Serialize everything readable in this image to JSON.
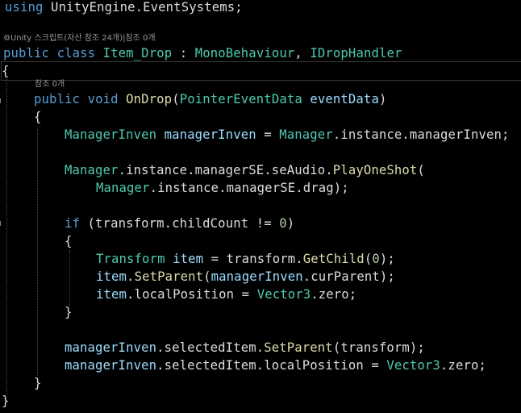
{
  "code": {
    "line_using": {
      "kw": "using",
      "ns": " UnityEngine.EventSystems;"
    },
    "lens_class": {
      "icon": "⚙",
      "text": "Unity 스크립트(자산 참조 24개)|참조 0개"
    },
    "line_class": {
      "kw1": "public",
      "sp1": " ",
      "kw2": "class",
      "sp2": " ",
      "name": "Item_Drop",
      "colon": " : ",
      "base1": "MonoBehaviour",
      "comma": ", ",
      "base2": "IDropHandler"
    },
    "line_open1": "{",
    "lens_method": "참조 0개",
    "line_method": {
      "kw1": "public",
      "sp1": " ",
      "kw2": "void",
      "sp2": " ",
      "name": "OnDrop",
      "p1": "(",
      "ptype": "PointerEventData",
      "sp3": " ",
      "pname": "eventData",
      "p2": ")"
    },
    "line_open2": "{",
    "line_mi": {
      "type": "ManagerInven",
      "sp": " ",
      "var": "managerInven",
      "eq": " = ",
      "cls": "Manager",
      "rest": ".instance.managerInven;"
    },
    "line_play": {
      "cls": "Manager",
      "rest": ".instance.managerSE.seAudio.",
      "method": "PlayOneShot",
      "p": "("
    },
    "line_play2": {
      "cls": "Manager",
      "rest": ".instance.managerSE.drag);"
    },
    "line_if": {
      "kw": "if",
      "a": " (transform.childCount != ",
      "num": "0",
      "b": ")"
    },
    "line_open3": "{",
    "line_t": {
      "type": "Transform",
      "sp": " ",
      "var": "item",
      "a": " = transform.",
      "method": "GetChild",
      "p1": "(",
      "num": "0",
      "p2": ");"
    },
    "line_sp": {
      "var": "item",
      "dot": ".",
      "method": "SetParent",
      "p1": "(",
      "var2": "managerInven",
      "rest": ".curParent);"
    },
    "line_lp": {
      "var": "item",
      "a": ".localPosition = ",
      "type": "Vector3",
      "rest": ".zero;"
    },
    "line_close3": "}",
    "line_ssp": {
      "var": "managerInven",
      "a": ".selectedItem.",
      "method": "SetParent",
      "rest": "(transform);"
    },
    "line_slp": {
      "var": "managerInven",
      "a": ".selectedItem.localPosition = ",
      "type": "Vector3",
      "rest": ".zero;"
    },
    "line_close2": "}",
    "line_close1": "}"
  },
  "colors": {
    "background": "#000000",
    "keyword": "#569cd6",
    "type": "#4ec9b0",
    "method": "#dcdcaa",
    "variable": "#9cdcfe",
    "number": "#b5cea8",
    "text": "#dcdcdc"
  }
}
